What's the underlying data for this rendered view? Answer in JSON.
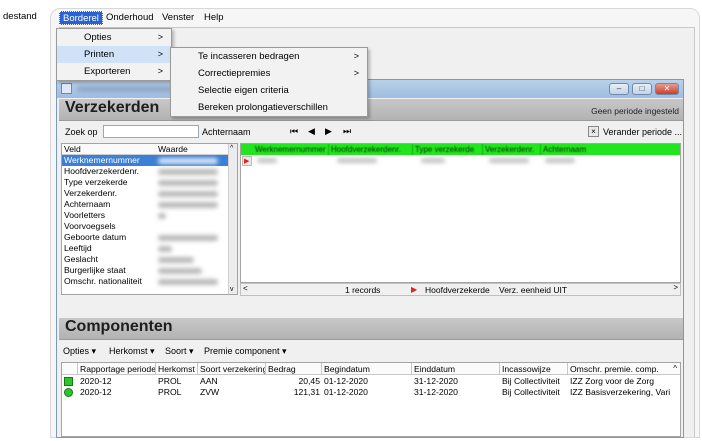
{
  "topbar": {
    "cut_left_label": "destand",
    "menus": [
      "Borderel",
      "Onderhoud",
      "Venster",
      "Help"
    ]
  },
  "borderel_menu": [
    {
      "label": "Opties",
      "submenu": true
    },
    {
      "label": "Printen",
      "submenu": true
    },
    {
      "label": "Exporteren",
      "submenu": true
    }
  ],
  "printen_menu": [
    {
      "label": "Te incasseren bedragen",
      "submenu": true
    },
    {
      "label": "Correctiepremies",
      "submenu": true
    },
    {
      "label": "Selectie eigen criteria",
      "submenu": false
    },
    {
      "label": "Bereken prolongatieverschillen",
      "submenu": false
    }
  ],
  "window": {
    "buttons": [
      "–",
      "□",
      "✕"
    ]
  },
  "verzekerden": {
    "title": "Verzekerden",
    "status": "Geen periode ingesteld",
    "search_label": "Zoek op",
    "search_value": "",
    "search_field": "Achternaam",
    "nav": [
      "⏮",
      "◀",
      "▶",
      "⏭"
    ],
    "change_period": "Verander periode ..."
  },
  "props": {
    "header_key": "Veld",
    "header_value": "Waarde",
    "rows": [
      "Werknemernummer",
      "Hoofdverzekerdenr.",
      "Type verzekerde",
      "Verzekerdenr.",
      "Achternaam",
      "Voorletters",
      "Voorvoegsels",
      "Geboorte datum",
      "Leeftijd",
      "Geslacht",
      "Burgerlijke staat",
      "Omschr. nationaliteit"
    ]
  },
  "grid": {
    "columns": [
      "Werknemernummer",
      "Hoofdverzekerdenr.",
      "Type verzekerde",
      "Verzekerdenr.",
      "Achternaam"
    ],
    "records": "1 records",
    "hoofd": "Hoofdverzekerde",
    "eenheid": "Verz. eenheid UIT"
  },
  "componenten": {
    "title": "Componenten",
    "toolbar": [
      "Opties",
      "Herkomst",
      "Soort",
      "Premie component"
    ],
    "columns": [
      "Rapportage periode",
      "Herkomst",
      "Soort verzekering",
      "Bedrag",
      "Begindatum",
      "Einddatum",
      "Incassowijze",
      "Omschr. premie. comp."
    ],
    "rows": [
      {
        "periode": "2020-12",
        "herkomst": "PROL",
        "soort": "AAN",
        "bedrag": "20,45",
        "begin": "01-12-2020",
        "eind": "31-12-2020",
        "incasso": "Bij Collectiviteit",
        "omschr": "IZZ Zorg voor de Zorg"
      },
      {
        "periode": "2020-12",
        "herkomst": "PROL",
        "soort": "ZVW",
        "bedrag": "121,31",
        "begin": "01-12-2020",
        "eind": "31-12-2020",
        "incasso": "Bij Collectiviteit",
        "omschr": "IZZ Basisverzekering, Vari"
      }
    ]
  },
  "colors": {
    "menu_active": "#2a63cf",
    "menu_highlight": "#cfe2f7",
    "grid_header": "#23e51f",
    "row_selected": "#3c7fd6",
    "record_marker": "#e0241b"
  }
}
